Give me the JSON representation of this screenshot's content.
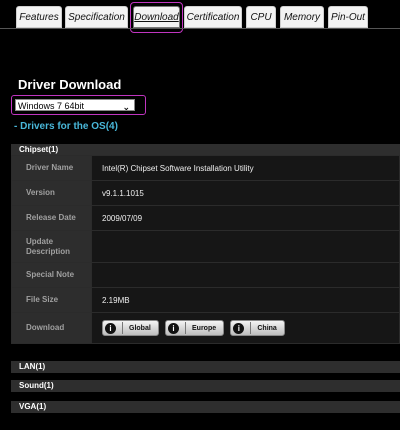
{
  "tabs": [
    {
      "label": "Features",
      "active": false
    },
    {
      "label": "Specification",
      "active": false
    },
    {
      "label": "Download",
      "active": true
    },
    {
      "label": "Certification",
      "active": false
    },
    {
      "label": "CPU",
      "active": false
    },
    {
      "label": "Memory",
      "active": false
    },
    {
      "label": "Pin-Out",
      "active": false
    }
  ],
  "page_title": "Driver Download",
  "os_select": {
    "value": "Windows 7 64bit"
  },
  "drivers_link": "- Drivers for the OS(4)",
  "chipset": {
    "header": "Chipset(1)",
    "rows": [
      {
        "label": "Driver Name",
        "value": "Intel(R) Chipset Software Installation Utility"
      },
      {
        "label": "Version",
        "value": "v9.1.1.1015"
      },
      {
        "label": "Release Date",
        "value": "2009/07/09"
      },
      {
        "label": "Update Description",
        "value": ""
      },
      {
        "label": "Special Note",
        "value": ""
      },
      {
        "label": "File Size",
        "value": "2.19MB"
      },
      {
        "label": "Download",
        "value": ""
      }
    ],
    "download_buttons": [
      {
        "label": "Global",
        "icon": "download-icon"
      },
      {
        "label": "Europe",
        "icon": "download-icon"
      },
      {
        "label": "China",
        "icon": "download-icon"
      }
    ]
  },
  "categories": [
    {
      "label": "LAN(1)"
    },
    {
      "label": "Sound(1)"
    },
    {
      "label": "VGA(1)"
    }
  ],
  "colors": {
    "accent_link": "#49b7d9",
    "highlight": "#c035c0"
  }
}
